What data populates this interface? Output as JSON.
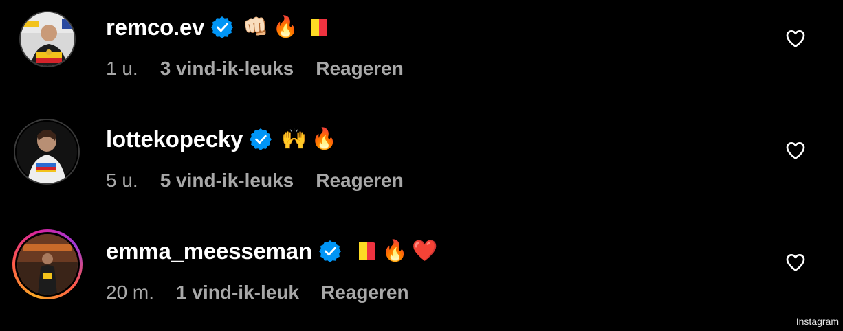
{
  "comments": [
    {
      "username": "remco.ev",
      "verified": true,
      "emojis": [
        "👊🏻",
        "🔥",
        "flag-be"
      ],
      "time": "1 u.",
      "likes": "3 vind-ik-leuks",
      "reply": "Reageren",
      "avatar_icon": "avatar-photo",
      "like_icon": "heart-outline-icon"
    },
    {
      "username": "lottekopecky",
      "verified": true,
      "emojis": [
        "🙌",
        "🔥"
      ],
      "time": "5 u.",
      "likes": "5 vind-ik-leuks",
      "reply": "Reageren",
      "avatar_icon": "avatar-photo",
      "like_icon": "heart-outline-icon"
    },
    {
      "username": "emma_meesseman",
      "verified": true,
      "emojis": [
        "flag-be",
        "🔥",
        "❤️"
      ],
      "time": "20 m.",
      "likes": "1 vind-ik-leuk",
      "reply": "Reageren",
      "avatar_icon": "avatar-photo-story-ring",
      "like_icon": "heart-outline-icon"
    }
  ],
  "watermark": "Instagram",
  "colors": {
    "background": "#000000",
    "username": "#ffffff",
    "meta": "#a8a8a8",
    "verified_badge": "#0095f6",
    "flag_be": [
      "#000000",
      "#FDDA24",
      "#EF3340"
    ]
  },
  "emoji_text": {
    "fist": "👊🏻",
    "fire": "🔥",
    "hands": "🙌",
    "heart": "❤️"
  }
}
